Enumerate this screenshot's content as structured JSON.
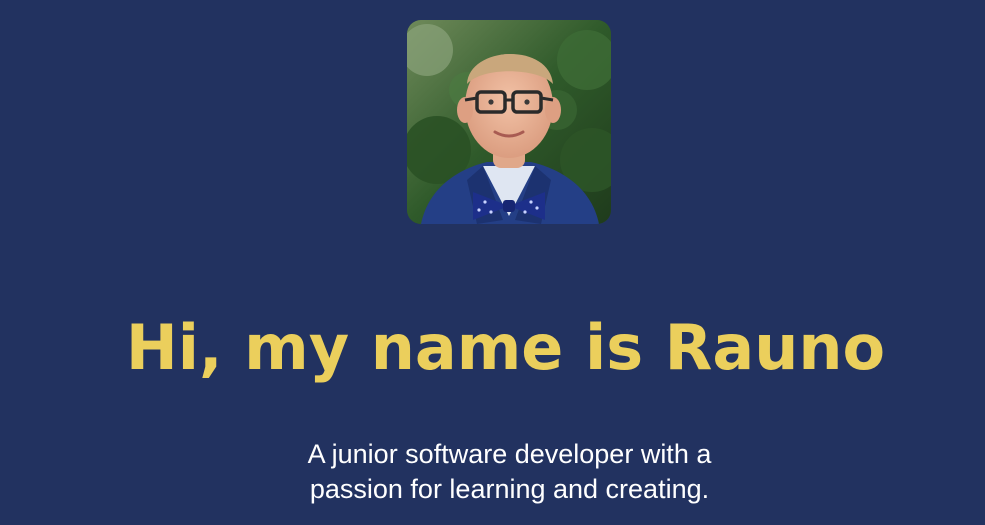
{
  "hero": {
    "avatar_icon": "profile-photo",
    "headline": "Hi, my name is Rauno",
    "tagline_line1": "A junior software developer with a",
    "tagline_line2": "passion for learning and creating."
  },
  "colors": {
    "background": "#223260",
    "headline": "#ebcf5c",
    "tagline": "#ffffff"
  }
}
